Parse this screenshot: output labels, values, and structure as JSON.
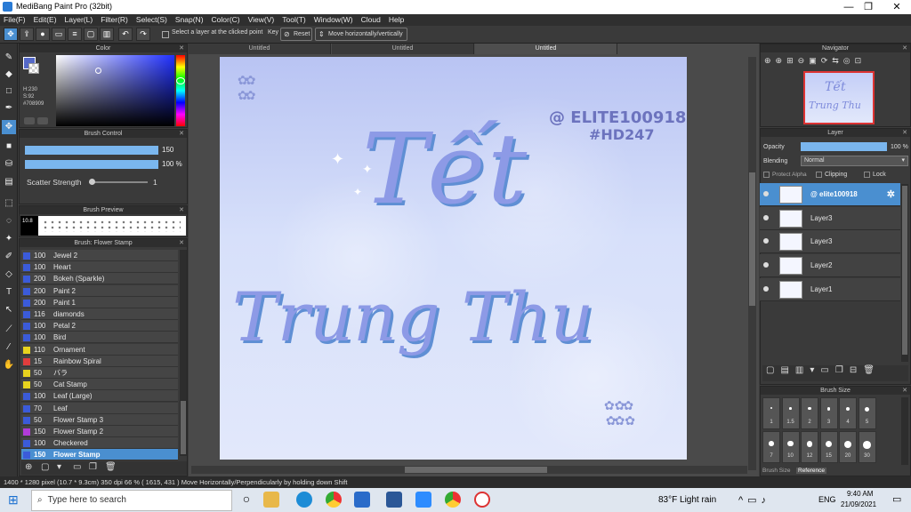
{
  "window": {
    "title": "MediBang Paint Pro (32bit)",
    "minimize": "—",
    "maximize": "❐",
    "close": "✕"
  },
  "menu": [
    "File(F)",
    "Edit(E)",
    "Layer(L)",
    "Filter(R)",
    "Select(S)",
    "Snap(N)",
    "Color(C)",
    "View(V)",
    "Tool(T)",
    "Window(W)",
    "Cloud",
    "Help"
  ],
  "toolbar": {
    "select_layer_label": "Select a layer at the clicked point",
    "key_label": "Key",
    "reset_label": "Reset",
    "move_label": "Move horizontally/vertically"
  },
  "doc_tabs": [
    "Untitled",
    "Untitled",
    "Untitled"
  ],
  "color_panel": {
    "title": "Color",
    "h": "H:230",
    "s": "S:92",
    "hex": "#708909",
    "main_color": "#5569c8"
  },
  "brush_control": {
    "title": "Brush Control",
    "size": "150",
    "opacity": "100 %",
    "scatter_label": "Scatter Strength",
    "scatter_value": "1"
  },
  "brush_preview": {
    "title": "Brush Preview",
    "value": "10.8"
  },
  "brush_list": {
    "title": "Brush: Flower Stamp",
    "items": [
      {
        "size": "100",
        "name": "Jewel 2",
        "color": "#3b5bd9"
      },
      {
        "size": "100",
        "name": "Heart",
        "color": "#3b5bd9"
      },
      {
        "size": "200",
        "name": "Bokeh (Sparkle)",
        "color": "#3b5bd9"
      },
      {
        "size": "200",
        "name": "Paint 2",
        "color": "#3b5bd9"
      },
      {
        "size": "200",
        "name": "Paint 1",
        "color": "#3b5bd9"
      },
      {
        "size": "116",
        "name": "diamonds",
        "color": "#3b5bd9"
      },
      {
        "size": "100",
        "name": "Petal 2",
        "color": "#3b5bd9"
      },
      {
        "size": "100",
        "name": "Bird",
        "color": "#3b5bd9"
      },
      {
        "size": "110",
        "name": "Ornament",
        "color": "#e8d31e"
      },
      {
        "size": "15",
        "name": "Rainbow Spiral",
        "color": "#e03d3d"
      },
      {
        "size": "50",
        "name": "バラ",
        "color": "#e8d31e"
      },
      {
        "size": "50",
        "name": "Cat Stamp",
        "color": "#e8d31e"
      },
      {
        "size": "100",
        "name": "Leaf (Large)",
        "color": "#3b5bd9"
      },
      {
        "size": "70",
        "name": "Leaf",
        "color": "#3b5bd9"
      },
      {
        "size": "50",
        "name": "Flower Stamp 3",
        "color": "#3b5bd9"
      },
      {
        "size": "150",
        "name": "Flower Stamp 2",
        "color": "#b23bd9"
      },
      {
        "size": "100",
        "name": "Checkered",
        "color": "#3b5bd9"
      },
      {
        "size": "150",
        "name": "Flower Stamp",
        "color": "#3b5bd9"
      }
    ]
  },
  "canvas_art": {
    "watermark_line1": "@ ELITE100918",
    "watermark_line2": "#HD247",
    "title_line1": "Tết",
    "title_line2": "Trung Thu"
  },
  "navigator": {
    "title": "Navigator"
  },
  "layer_panel": {
    "title": "Layer",
    "opacity_label": "Opacity",
    "opacity_value": "100 %",
    "blending_label": "Blending",
    "blending_value": "Normal",
    "protect_alpha": "Protect Alpha",
    "clipping": "Clipping",
    "lock": "Lock",
    "layers": [
      {
        "name": "@ elite100918",
        "selected": true
      },
      {
        "name": "Layer3"
      },
      {
        "name": "Layer3"
      },
      {
        "name": "Layer2"
      },
      {
        "name": "Layer1"
      }
    ]
  },
  "brush_size": {
    "title": "Brush Size",
    "values": [
      "1",
      "1.5",
      "2",
      "3",
      "4",
      "5",
      "7",
      "10",
      "12",
      "15",
      "20",
      "30"
    ],
    "tab1": "Brush Size",
    "tab2": "Reference"
  },
  "status": {
    "text": "1400 * 1280 pixel  (10.7 * 9.3cm)  350 dpi  66 %  ( 1615, 431 )  Move Horizontally/Perpendicularly by holding down Shift"
  },
  "taskbar": {
    "search_placeholder": "Type here to search",
    "weather": "83°F  Light rain",
    "lang": "ENG",
    "time": "9:40 AM",
    "date": "21/09/2021"
  }
}
